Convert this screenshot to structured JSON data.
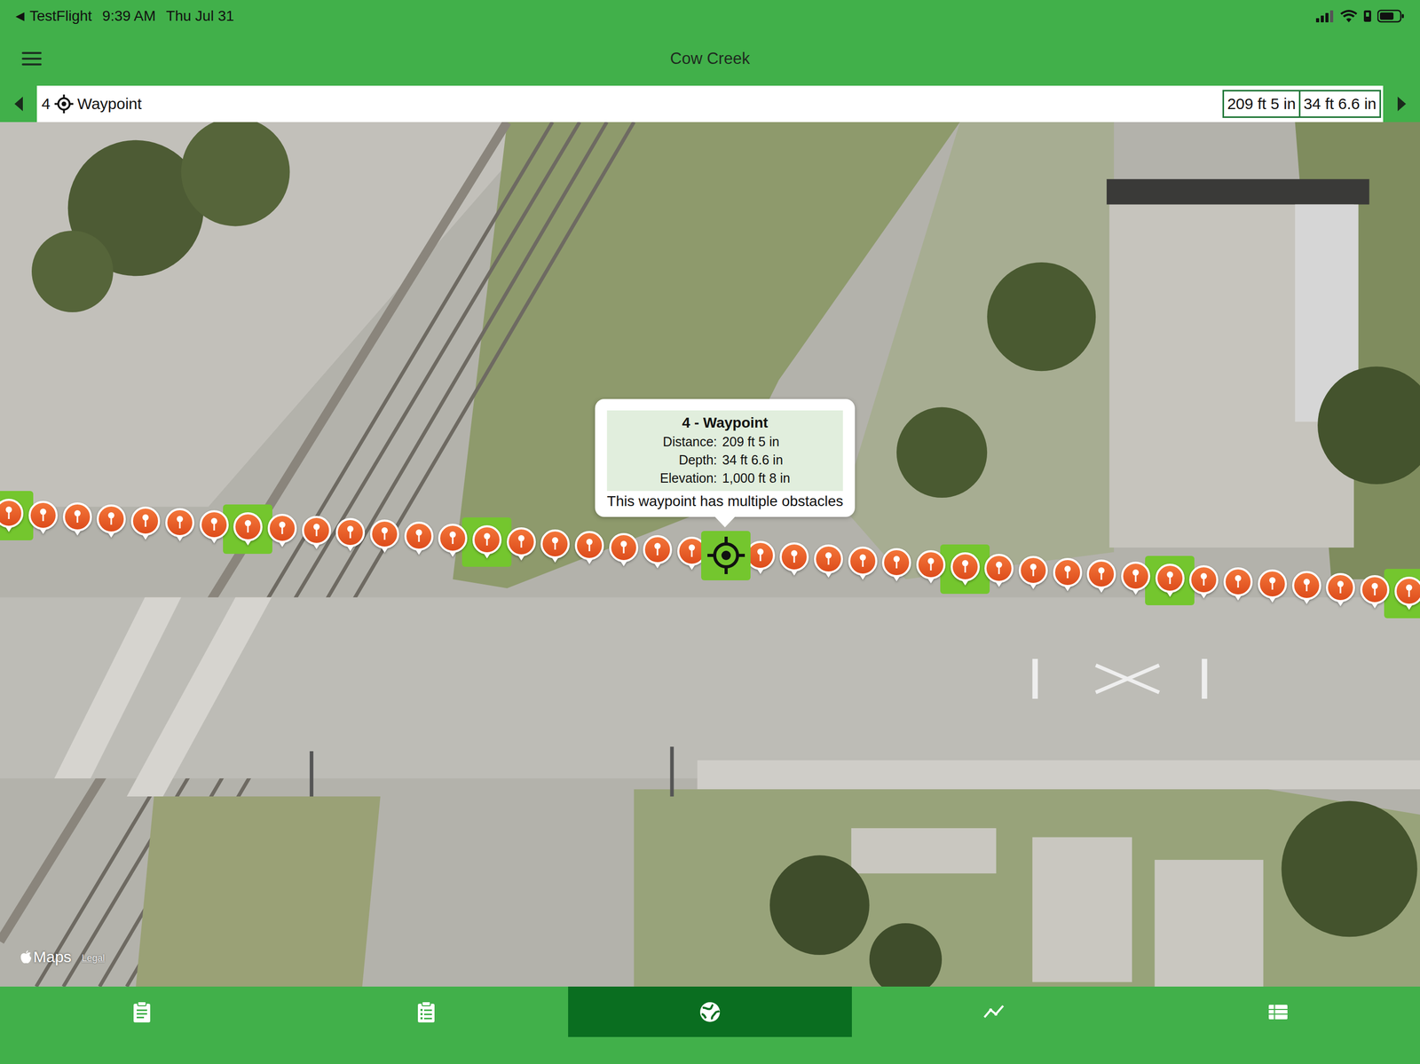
{
  "status_bar": {
    "back": "◀",
    "app": "TestFlight",
    "time": "9:39 AM",
    "date": "Thu Jul 31"
  },
  "nav": {
    "title": "Cow Creek"
  },
  "waypoint_bar": {
    "number": "4",
    "label": "Waypoint",
    "distance": "209 ft 5 in",
    "depth": "34 ft 6.6 in"
  },
  "callout": {
    "title": "4 - Waypoint",
    "rows": [
      {
        "label": "Distance:",
        "value": "209 ft 5 in"
      },
      {
        "label": "Depth:",
        "value": "34 ft 6.6 in"
      },
      {
        "label": "Elevation:",
        "value": "1,000 ft 8 in"
      }
    ],
    "note": "This waypoint has multiple obstacles"
  },
  "pins": [
    {
      "kind": "pin",
      "highlighted": true
    },
    {
      "kind": "pin",
      "highlighted": false
    },
    {
      "kind": "pin",
      "highlighted": false
    },
    {
      "kind": "pin",
      "highlighted": false
    },
    {
      "kind": "pin",
      "highlighted": false
    },
    {
      "kind": "pin",
      "highlighted": false
    },
    {
      "kind": "pin",
      "highlighted": false
    },
    {
      "kind": "pin",
      "highlighted": true
    },
    {
      "kind": "pin",
      "highlighted": false
    },
    {
      "kind": "pin",
      "highlighted": false
    },
    {
      "kind": "pin",
      "highlighted": false
    },
    {
      "kind": "pin",
      "highlighted": false
    },
    {
      "kind": "pin",
      "highlighted": false
    },
    {
      "kind": "pin",
      "highlighted": false
    },
    {
      "kind": "pin",
      "highlighted": true
    },
    {
      "kind": "pin",
      "highlighted": false
    },
    {
      "kind": "pin",
      "highlighted": false
    },
    {
      "kind": "pin",
      "highlighted": false
    },
    {
      "kind": "pin",
      "highlighted": false
    },
    {
      "kind": "pin",
      "highlighted": false
    },
    {
      "kind": "pin",
      "highlighted": false
    },
    {
      "kind": "waypoint",
      "highlighted": true
    },
    {
      "kind": "pin",
      "highlighted": false
    },
    {
      "kind": "pin",
      "highlighted": false
    },
    {
      "kind": "pin",
      "highlighted": false
    },
    {
      "kind": "pin",
      "highlighted": false
    },
    {
      "kind": "pin",
      "highlighted": false
    },
    {
      "kind": "pin",
      "highlighted": false
    },
    {
      "kind": "pin",
      "highlighted": true
    },
    {
      "kind": "pin",
      "highlighted": false
    },
    {
      "kind": "pin",
      "highlighted": false
    },
    {
      "kind": "pin",
      "highlighted": false
    },
    {
      "kind": "pin",
      "highlighted": false
    },
    {
      "kind": "pin",
      "highlighted": false
    },
    {
      "kind": "pin",
      "highlighted": true
    },
    {
      "kind": "pin",
      "highlighted": false
    },
    {
      "kind": "pin",
      "highlighted": false
    },
    {
      "kind": "pin",
      "highlighted": false
    },
    {
      "kind": "pin",
      "highlighted": false
    },
    {
      "kind": "pin",
      "highlighted": false
    },
    {
      "kind": "pin",
      "highlighted": false
    },
    {
      "kind": "pin",
      "highlighted": true
    }
  ],
  "map_attribution": {
    "logo": "Maps",
    "legal": "Legal"
  },
  "tabs": [
    {
      "selected": false
    },
    {
      "selected": false
    },
    {
      "selected": true
    },
    {
      "selected": false
    },
    {
      "selected": false
    }
  ]
}
